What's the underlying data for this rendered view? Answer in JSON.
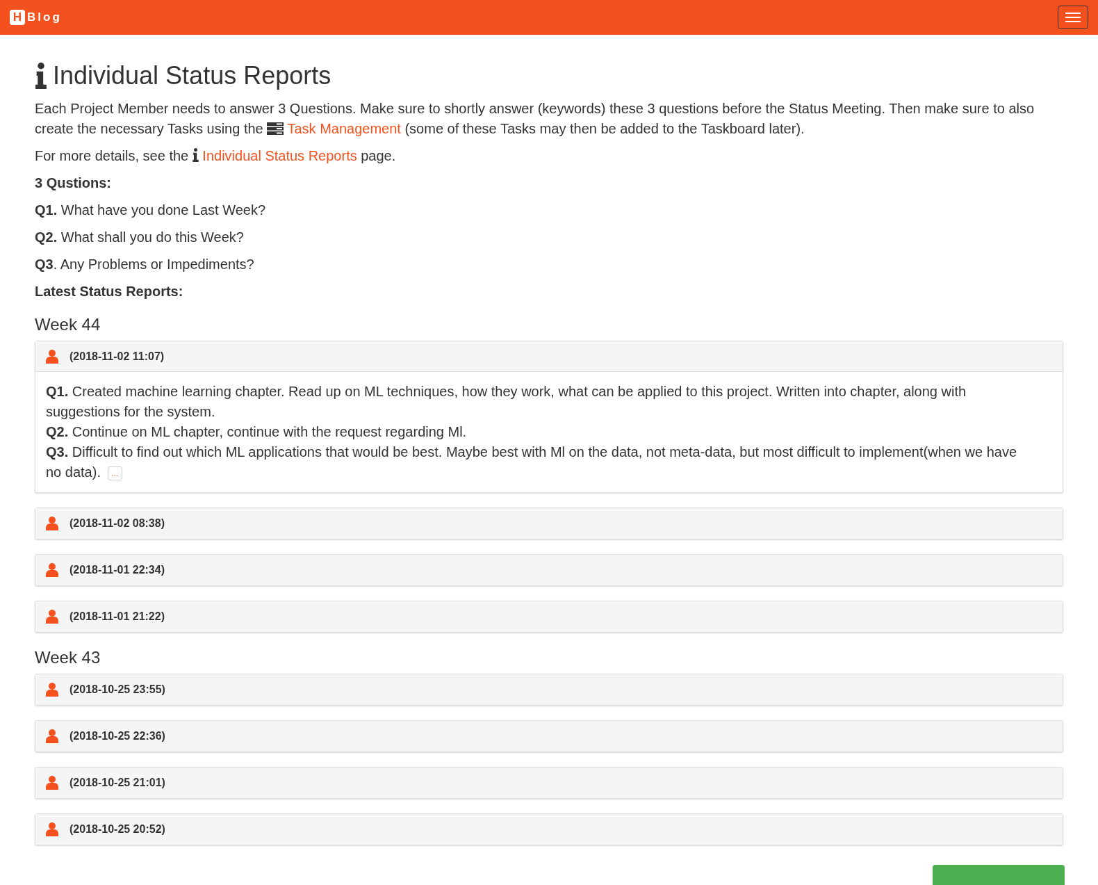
{
  "navbar": {
    "brand_letter": "H",
    "brand": "Blog"
  },
  "title": "Individual Status Reports",
  "intro": {
    "before": "Each Project Member needs to answer 3 Questions. Make sure to shortly answer (keywords) these 3 questions before the Status Meeting. Then make sure to also create the necessary Tasks using the",
    "link": "Task Management",
    "after": "(some of these Tasks may then be added to the Taskboard later)."
  },
  "details": {
    "before": "For more details, see the",
    "link": "Individual Status Reports",
    "after": "page."
  },
  "questions_heading": "3 Qustions:",
  "questions": [
    "**Q1.** What have you done Last Week?",
    "**Q2.** What shall you do this Week?",
    "**Q3**. Any Problems or Impediments?"
  ],
  "latest_heading": "Latest Status Reports:",
  "weeks": [
    {
      "heading": "Week 44",
      "reports": [
        {
          "time": "(2018-11-02 11:07)",
          "expanded": true,
          "answers": [
            "**Q1.** Created machine learning chapter. Read up on ML techniques, how they work, what can be applied to this project. Written into chapter, along with suggestions for the system.",
            "**Q2.** Continue on ML chapter, continue with the request regarding Ml.",
            "**Q3.** Difficult to find out which ML applications that would be best. Maybe best with Ml on the data, not meta-data, but most difficult to implement(when we have no data)."
          ],
          "more": "..."
        },
        {
          "time": "(2018-11-02 08:38)",
          "expanded": false
        },
        {
          "time": "(2018-11-01 22:34)",
          "expanded": false
        },
        {
          "time": "(2018-11-01 21:22)",
          "expanded": false
        }
      ]
    },
    {
      "heading": "Week 43",
      "reports": [
        {
          "time": "(2018-10-25 23:55)",
          "expanded": false
        },
        {
          "time": "(2018-10-25 22:36)",
          "expanded": false
        },
        {
          "time": "(2018-10-25 21:01)",
          "expanded": false
        },
        {
          "time": "(2018-10-25 20:52)",
          "expanded": false
        }
      ]
    }
  ]
}
